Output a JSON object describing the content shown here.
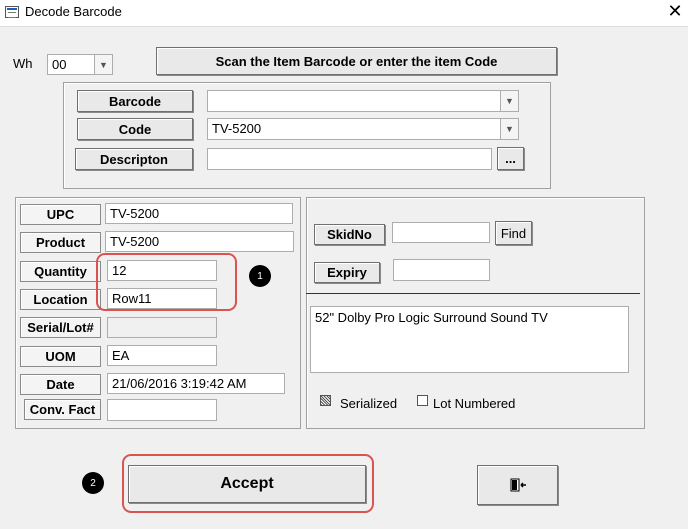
{
  "window": {
    "title": "Decode Barcode",
    "close_glyph": "✕"
  },
  "warehouse": {
    "label": "Wh",
    "value": "00"
  },
  "scan_button": "Scan the Item Barcode  or enter the item Code",
  "lookup": {
    "barcode_label": "Barcode",
    "barcode_value": "",
    "code_label": "Code",
    "code_value": "TV-5200",
    "description_label": "Descripton",
    "description_value": "",
    "ellipsis": "..."
  },
  "details": {
    "upc_label": "UPC",
    "upc_value": "TV-5200",
    "product_label": "Product",
    "product_value": "TV-5200",
    "quantity_label": "Quantity",
    "quantity_value": "12",
    "location_label": "Location",
    "location_value": "Row11",
    "serial_label": "Serial/Lot#",
    "serial_value": "",
    "uom_label": "UOM",
    "uom_value": "EA",
    "date_label": "Date",
    "date_value": "21/06/2016 3:19:42 AM",
    "conv_label": "Conv. Fact",
    "conv_value": ""
  },
  "right": {
    "skid_label": "SkidNo",
    "skid_value": "",
    "find_label": "Find",
    "expiry_label": "Expiry",
    "expiry_value": "",
    "item_description": "52\" Dolby Pro Logic Surround Sound TV",
    "serialized_label": "Serialized",
    "serialized_checked": true,
    "lot_label": "Lot Numbered",
    "lot_checked": false
  },
  "accept_label": "Accept",
  "exit_icon": "exit-door-icon",
  "annotations": {
    "badge1": "1",
    "badge2": "2"
  },
  "colors": {
    "highlight": "#d9534f",
    "form_bg": "#f0f0f0"
  }
}
